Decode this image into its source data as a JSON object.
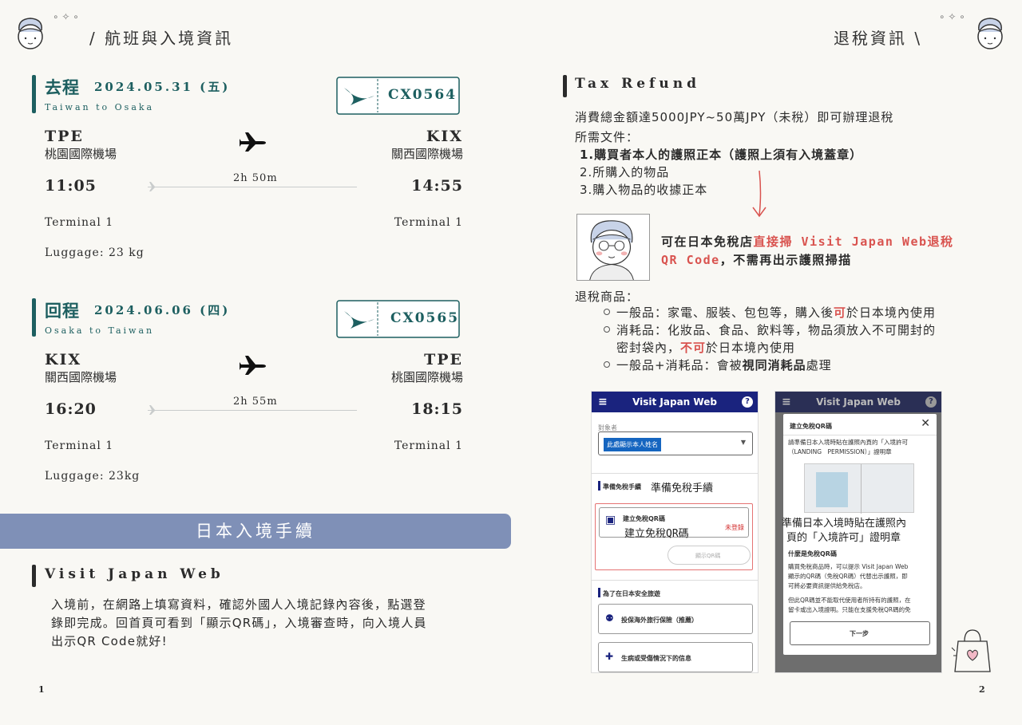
{
  "left_page": {
    "title": "航班與入境資訊",
    "outbound": {
      "label": "去程",
      "date": "2024.05.31 (五)",
      "route": "Taiwan to Osaka",
      "flight_no": "CX0564",
      "from_code": "TPE",
      "from_airport": "桃園國際機場",
      "to_code": "KIX",
      "to_airport": "關西國際機場",
      "depart_time": "11:05",
      "arrive_time": "14:55",
      "duration": "2h 50m",
      "from_terminal": "Terminal 1",
      "to_terminal": "Terminal 1",
      "luggage": "Luggage: 23 kg"
    },
    "return": {
      "label": "回程",
      "date": "2024.06.06 (四)",
      "route": "Osaka to Taiwan",
      "flight_no": "CX0565",
      "from_code": "KIX",
      "from_airport": "關西國際機場",
      "to_code": "TPE",
      "to_airport": "桃園國際機場",
      "depart_time": "16:20",
      "arrive_time": "18:15",
      "duration": "2h 55m",
      "from_terminal": "Terminal 1",
      "to_terminal": "Terminal 1",
      "luggage": "Luggage: 23kg"
    },
    "banner": "日本入境手續",
    "vjw_title": "Visit Japan Web",
    "vjw_lines": [
      "入境前，在網路上填寫資料，確認外國人入境記錄內容後，點選登",
      "錄即完成。回首頁可看到「顯示QR碼」，入境審查時，向入境人員",
      "出示QR Code就好!"
    ],
    "page_number": "1"
  },
  "right_page": {
    "title": "退稅資訊",
    "section_title": "Tax Refund",
    "line1": "消費總金額達5000JPY~50萬JPY（未稅）即可辦理退稅",
    "docs_label": "所需文件：",
    "doc1": "1.購買者本人的護照正本（護照上須有入境蓋章）",
    "doc2": "2.所購入的物品",
    "doc3": "3.購入物品的收據正本",
    "callout": {
      "a": "可在日本免稅店",
      "b": "直接掃 Visit Japan Web退稅",
      "c": "QR Code",
      "d": "，不需再出示護照掃描"
    },
    "goods_label": "退稅商品：",
    "goods": {
      "g1a": "一般品：家電、服裝、包包等，購入後",
      "g1b": "可",
      "g1c": "於日本境內使用",
      "g2a": "消耗品：化妝品、食品、飲料等，物品須放入不可開封的",
      "g2b": "密封袋內，",
      "g2c": "不可",
      "g2d": "於日本境內使用",
      "g3a": "一般品+消耗品：會被",
      "g3b": "視同消耗品",
      "g3c": "處理"
    },
    "phone1": {
      "header": "Visit Japan Web",
      "subject_label": "對象者",
      "name_chip": "此處顯示本人姓名",
      "section": "準備免稅手續",
      "section_note": "準備免稅手續",
      "card_title": "建立免稅QR碼",
      "card_note": "建立免稅QR碼",
      "status": "未登錄",
      "qr_button": "顯示QR碼",
      "safety": "為了在日本安全旅遊",
      "insurance": "投保海外旅行保險（推薦）",
      "illness": "生病或受傷情況下的信息"
    },
    "phone2": {
      "header": "Visit Japan Web",
      "modal_title": "建立免稅QR碼",
      "modal_text1": "請準備日本入境時貼在護照內頁的「入境許可",
      "modal_text2": "（LANDING　PERMISSION）」證明章",
      "note1": "準備日本入境時貼在護照內",
      "note2": "頁的「入境許可」證明章",
      "q_title": "什麼是免稅QR碼",
      "q_text1": "購買免稅商品時，可以提示 Visit Japan Web",
      "q_text2": "顯示的QR碼（免稅QR碼）代替出示護照，即",
      "q_text3": "可將必要資訊提供給免稅店。",
      "q_text4": "但此QR碼並不能取代使用者所持有的護照，在",
      "q_text5": "留卡或出入境證明。只能在支援免稅QR碼的免",
      "next": "下一步"
    },
    "page_number": "2"
  },
  "colors": {
    "teal": "#1d5f60",
    "banner": "#7f90b7",
    "red": "#d9534f",
    "vjw_navy": "#1a237e"
  }
}
